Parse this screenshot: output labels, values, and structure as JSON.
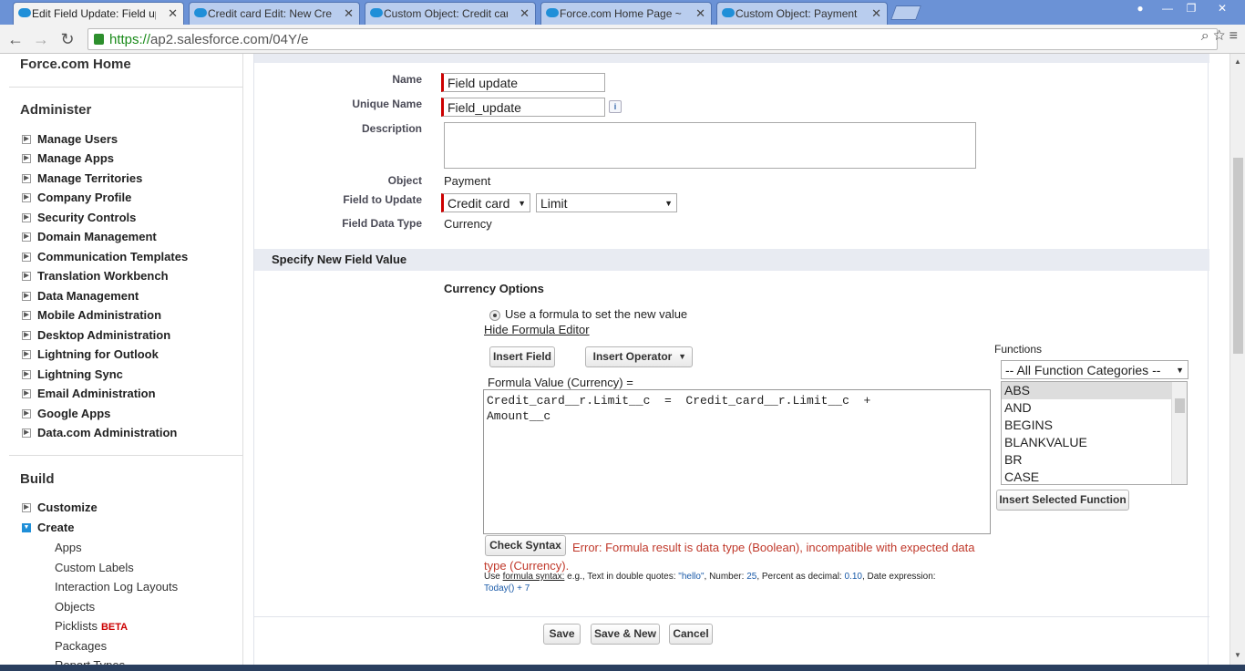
{
  "browser": {
    "tabs": [
      {
        "label": "Edit Field Update: Field up",
        "active": true
      },
      {
        "label": "Credit card Edit: New Cred",
        "active": false
      },
      {
        "label": "Custom Object: Credit car",
        "active": false
      },
      {
        "label": "Force.com Home Page ~ S",
        "active": false
      },
      {
        "label": "Custom Object: Payment ~",
        "active": false
      }
    ],
    "url_scheme": "https://",
    "url_rest": "ap2.salesforce.com/04Y/e",
    "close_glyph": "✕"
  },
  "sidebar": {
    "home": "Force.com Home",
    "administer_title": "Administer",
    "administer_items": [
      "Manage Users",
      "Manage Apps",
      "Manage Territories",
      "Company Profile",
      "Security Controls",
      "Domain Management",
      "Communication Templates",
      "Translation Workbench",
      "Data Management",
      "Mobile Administration",
      "Desktop Administration",
      "Lightning for Outlook",
      "Lightning Sync",
      "Email Administration",
      "Google Apps",
      "Data.com Administration"
    ],
    "build_title": "Build",
    "build_items": [
      "Customize",
      "Create"
    ],
    "create_subitems": [
      "Apps",
      "Custom Labels",
      "Interaction Log Layouts",
      "Objects",
      "Picklists",
      "Packages",
      "Report Types"
    ],
    "beta": "BETA"
  },
  "form": {
    "name_label": "Name",
    "name_value": "Field update",
    "unique_label": "Unique Name",
    "unique_value": "Field_update",
    "info_glyph": "i",
    "description_label": "Description",
    "object_label": "Object",
    "object_value": "Payment",
    "field_label": "Field to Update",
    "field_object": "Credit card",
    "field_field": "Limit",
    "datatype_label": "Field Data Type",
    "datatype_value": "Currency"
  },
  "section": {
    "title": "Specify New Field Value",
    "currency_options": "Currency Options",
    "radio_label": "Use a formula to set the new value",
    "hide_editor": "Hide Formula Editor",
    "insert_field": "Insert Field",
    "insert_operator": "Insert Operator",
    "formula_label": "Formula Value (Currency) =",
    "formula_text": "Credit_card__r.Limit__c  =  Credit_card__r.Limit__c  +\nAmount__c",
    "functions_label": "Functions",
    "function_category": "-- All Function Categories --",
    "functions": [
      "ABS",
      "AND",
      "BEGINS",
      "BLANKVALUE",
      "BR",
      "CASE"
    ],
    "insert_function": "Insert Selected Function",
    "check_syntax": "Check Syntax",
    "error": "Error: Formula result is data type (Boolean), incompatible with expected data type (Currency).",
    "hint_prefix": "Use ",
    "hint_link": "formula syntax:",
    "hint_mid1": " e.g., Text in double quotes: ",
    "hint_q": "\"hello\"",
    "hint_mid2": ", Number: ",
    "hint_num": "25",
    "hint_mid3": ", Percent as decimal: ",
    "hint_pct": "0.10",
    "hint_mid4": ", Date expression:",
    "hint_date": "Today() + 7"
  },
  "actions": {
    "save": "Save",
    "save_new": "Save & New",
    "cancel": "Cancel"
  }
}
